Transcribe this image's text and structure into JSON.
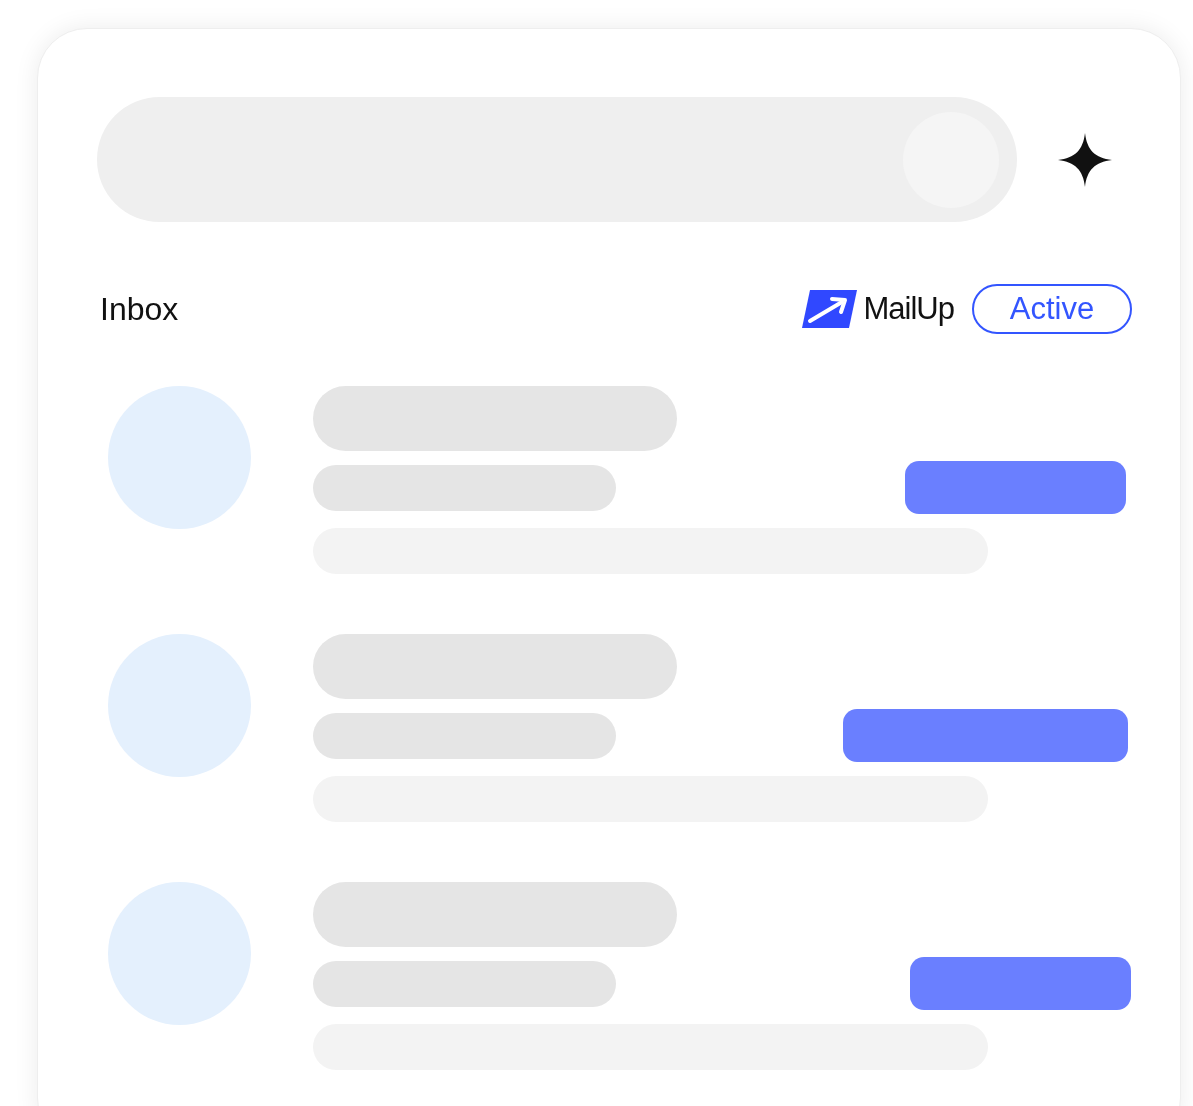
{
  "header": {
    "title": "Inbox",
    "brand": "MailUp",
    "status": "Active"
  },
  "rows": [
    {
      "kind": "placeholder"
    },
    {
      "kind": "placeholder"
    },
    {
      "kind": "placeholder"
    }
  ]
}
